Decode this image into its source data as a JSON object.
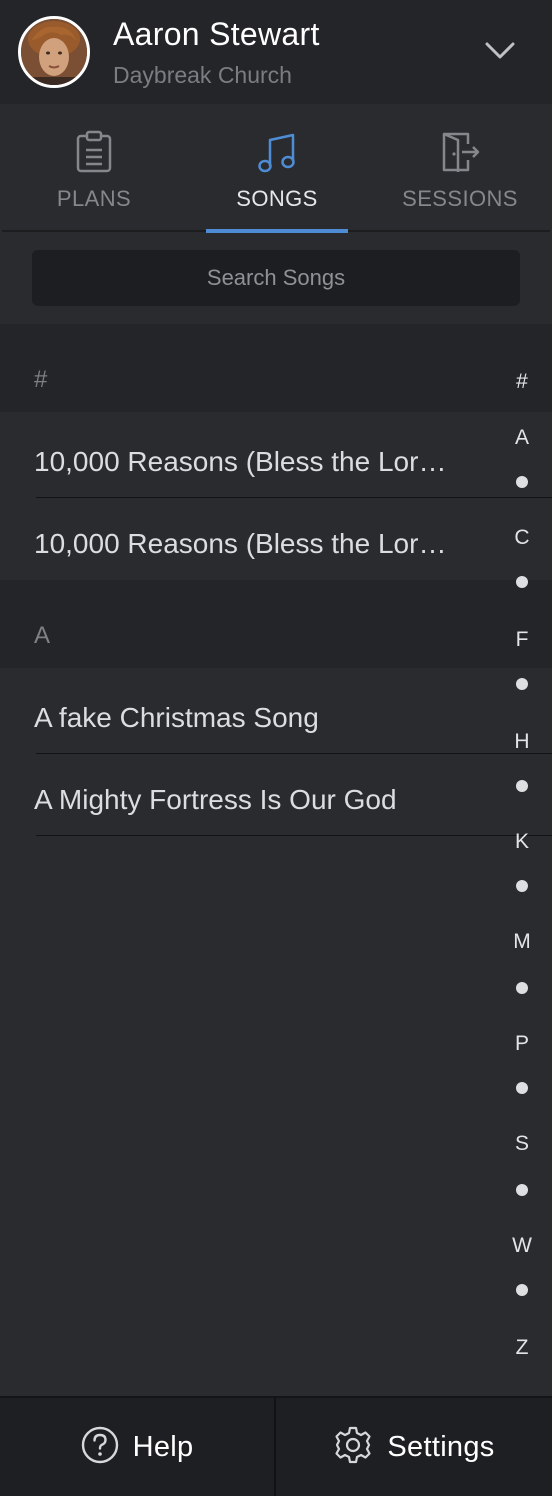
{
  "user": {
    "name": "Aaron Stewart",
    "church": "Daybreak Church"
  },
  "tabs": [
    {
      "label": "PLANS",
      "icon": "clipboard-icon",
      "active": false
    },
    {
      "label": "SONGS",
      "icon": "music-note-icon",
      "active": true
    },
    {
      "label": "SESSIONS",
      "icon": "exit-door-icon",
      "active": false
    }
  ],
  "search": {
    "placeholder": "Search Songs",
    "value": ""
  },
  "sections": [
    {
      "title": "#",
      "songs": [
        "10,000 Reasons (Bless the Lor…",
        "10,000 Reasons (Bless the Lor…"
      ]
    },
    {
      "title": "A",
      "songs": [
        "A fake Christmas Song",
        "A Mighty Fortress Is Our God"
      ]
    }
  ],
  "alpha_index": [
    "#",
    "A",
    "•",
    "C",
    "•",
    "F",
    "•",
    "H",
    "•",
    "K",
    "•",
    "M",
    "•",
    "P",
    "•",
    "S",
    "•",
    "W",
    "•",
    "Z"
  ],
  "footer": {
    "help_label": "Help",
    "settings_label": "Settings"
  },
  "colors": {
    "accent": "#4e8dd6",
    "background": "#2a2b2e",
    "header_bg": "#242528"
  }
}
